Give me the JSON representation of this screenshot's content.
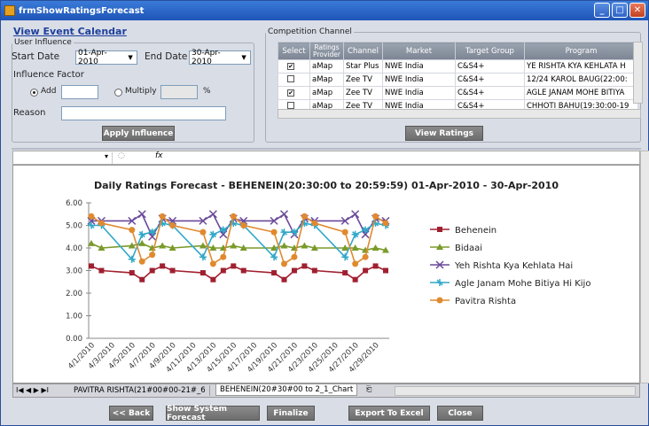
{
  "window": {
    "title": "frmShowRatingsForecast"
  },
  "link": "View Event Calendar",
  "user_influence": {
    "legend": "User Influence",
    "start_label": "Start Date",
    "start_value": "01-Apr-2010",
    "end_label": "End Date",
    "end_value": "30-Apr-2010",
    "factor_label": "Influence Factor",
    "add_label": "Add",
    "multiply_label": "Multiply",
    "percent": "%",
    "reason_label": "Reason",
    "apply_label": "Apply Influence"
  },
  "competition": {
    "legend": "Competition Channel",
    "headers": [
      "Select",
      "Ratings Provider",
      "Channel",
      "Market",
      "Target Group",
      "Program"
    ],
    "rows": [
      {
        "checked": true,
        "provider": "aMap",
        "channel": "Star Plus",
        "market": "NWE India",
        "tg": "C&S4+",
        "program": "YE RISHTA KYA KEHLATA H"
      },
      {
        "checked": false,
        "provider": "aMap",
        "channel": "Zee TV",
        "market": "NWE India",
        "tg": "C&S4+",
        "program": "12/24 KAROL BAUG(22:00:"
      },
      {
        "checked": true,
        "provider": "aMap",
        "channel": "Zee TV",
        "market": "NWE India",
        "tg": "C&S4+",
        "program": "AGLE JANAM MOHE BITIYA"
      },
      {
        "checked": false,
        "provider": "aMap",
        "channel": "Zee TV",
        "market": "NWE India",
        "tg": "C&S4+",
        "program": "CHHOTI BAHU(19:30:00-19"
      }
    ],
    "view_label": "View Ratings"
  },
  "sheet": {
    "cellref": "",
    "formula_icon": "fx"
  },
  "tabs": {
    "nav": "I◀ ◀ ▶ ▶I",
    "tab1": "PAVITRA RISHTA(21#00#00-21#_6",
    "tab2": "BEHENEIN(20#30#00 to 2_1_Chart"
  },
  "buttons": {
    "back": "<< Back",
    "forecast": "Show System Forecast",
    "finalize": "Finalize",
    "export": "Export To Excel",
    "close": "Close"
  },
  "chart_data": {
    "type": "line",
    "title": "Daily Ratings Forecast - BEHENEIN(20:30:00 to 20:59:59) 01-Apr-2010 - 30-Apr-2010",
    "ylim": [
      0,
      6
    ],
    "yticks": [
      "0.00",
      "1.00",
      "2.00",
      "3.00",
      "4.00",
      "5.00",
      "6.00"
    ],
    "categories": [
      "4/1/2010",
      "4/2/2010",
      "4/3/2010",
      "4/4/2010",
      "4/5/2010",
      "4/6/2010",
      "4/7/2010",
      "4/8/2010",
      "4/9/2010",
      "4/10/2010",
      "4/11/2010",
      "4/12/2010",
      "4/13/2010",
      "4/14/2010",
      "4/15/2010",
      "4/16/2010",
      "4/17/2010",
      "4/18/2010",
      "4/19/2010",
      "4/20/2010",
      "4/21/2010",
      "4/22/2010",
      "4/23/2010",
      "4/24/2010",
      "4/25/2010",
      "4/26/2010",
      "4/27/2010",
      "4/28/2010",
      "4/29/2010",
      "4/30/2010"
    ],
    "xtick_labels": [
      "4/1/2010",
      "4/3/2010",
      "4/5/2010",
      "4/7/2010",
      "4/9/2010",
      "4/11/2010",
      "4/13/2010",
      "4/15/2010",
      "4/17/2010",
      "4/19/2010",
      "4/21/2010",
      "4/23/2010",
      "4/25/2010",
      "4/27/2010",
      "4/29/2010"
    ],
    "legend_position": "right",
    "series": [
      {
        "name": "Behenein",
        "color": "#a02030",
        "marker": "square",
        "values": [
          3.2,
          3.0,
          null,
          null,
          2.9,
          2.6,
          3.0,
          3.2,
          3.0,
          null,
          null,
          2.9,
          2.6,
          3.0,
          3.2,
          3.0,
          null,
          null,
          2.9,
          2.6,
          3.0,
          3.2,
          3.0,
          null,
          null,
          2.9,
          2.6,
          3.0,
          3.2,
          3.0
        ]
      },
      {
        "name": "Bidaai",
        "color": "#7a9a2a",
        "marker": "triangle",
        "values": [
          4.2,
          4.0,
          null,
          null,
          4.1,
          4.2,
          4.0,
          4.1,
          4.0,
          null,
          null,
          4.1,
          4.0,
          4.0,
          4.1,
          4.0,
          null,
          null,
          4.0,
          4.1,
          4.0,
          4.1,
          4.0,
          null,
          null,
          4.0,
          4.0,
          3.9,
          4.0,
          3.9
        ]
      },
      {
        "name": "Yeh Rishta Kya Kehlata Hai",
        "color": "#6a4a9a",
        "marker": "x",
        "values": [
          5.2,
          5.2,
          null,
          null,
          5.2,
          5.5,
          4.5,
          5.3,
          5.2,
          null,
          null,
          5.2,
          5.5,
          4.6,
          5.3,
          5.2,
          null,
          null,
          5.2,
          5.5,
          4.6,
          5.3,
          5.2,
          null,
          null,
          5.2,
          5.5,
          4.6,
          5.3,
          5.2
        ]
      },
      {
        "name": "Agle Janam  Mohe Bitiya Hi Kijo",
        "color": "#30a8c8",
        "marker": "star",
        "values": [
          5.0,
          5.0,
          null,
          null,
          3.5,
          4.6,
          4.7,
          5.1,
          5.0,
          null,
          null,
          3.6,
          4.6,
          4.8,
          5.1,
          5.0,
          null,
          null,
          3.6,
          4.7,
          4.7,
          5.1,
          5.0,
          null,
          null,
          3.6,
          4.6,
          4.8,
          5.1,
          5.0
        ]
      },
      {
        "name": "Pavitra Rishta",
        "color": "#e08a30",
        "marker": "circle",
        "values": [
          5.4,
          5.1,
          null,
          null,
          4.8,
          3.4,
          3.7,
          5.4,
          5.0,
          null,
          null,
          4.7,
          3.3,
          3.6,
          5.4,
          5.0,
          null,
          null,
          4.7,
          3.3,
          3.6,
          5.4,
          5.1,
          null,
          null,
          4.7,
          3.3,
          3.6,
          5.4,
          5.1
        ]
      }
    ]
  }
}
